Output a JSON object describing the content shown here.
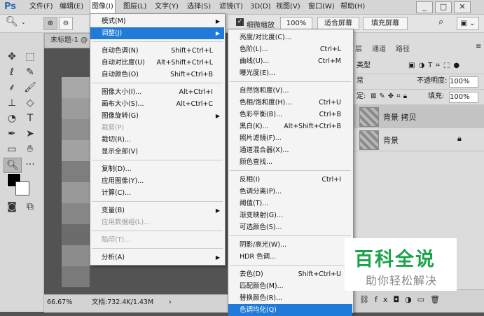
{
  "menubar": {
    "logo": "Ps",
    "items": [
      "文件(F)",
      "编辑(E)",
      "图像(I)",
      "图层(L)",
      "文字(Y)",
      "选择(S)",
      "滤镜(T)",
      "3D(D)",
      "视图(V)",
      "窗口(W)",
      "帮助(H)"
    ],
    "active_index": 2
  },
  "options_bar": {
    "scrubby_zoom_label": "细微缩放",
    "zoom_100": "100%",
    "fit_screen": "适合屏幕",
    "fill_screen": "填充屏幕"
  },
  "document": {
    "tab_title": "未标题-1 @",
    "zoom": "66.67%",
    "doc_size": "文档:732.4K/1.43M"
  },
  "image_menu": {
    "items": [
      {
        "label": "模式(M)",
        "shortcut": "",
        "arrow": true
      },
      {
        "label": "调整(J)",
        "shortcut": "",
        "arrow": true,
        "highlight": true
      },
      {
        "label": "自动色调(N)",
        "shortcut": "Shift+Ctrl+L"
      },
      {
        "label": "自动对比度(U)",
        "shortcut": "Alt+Shift+Ctrl+L"
      },
      {
        "label": "自动颜色(O)",
        "shortcut": "Shift+Ctrl+B"
      },
      {
        "label": "图像大小(I)...",
        "shortcut": "Alt+Ctrl+I"
      },
      {
        "label": "画布大小(S)...",
        "shortcut": "Alt+Ctrl+C"
      },
      {
        "label": "图像旋转(G)",
        "shortcut": "",
        "arrow": true
      },
      {
        "label": "裁剪(P)",
        "shortcut": "",
        "disabled": true
      },
      {
        "label": "裁切(R)...",
        "shortcut": ""
      },
      {
        "label": "显示全部(V)",
        "shortcut": ""
      },
      {
        "label": "复制(D)...",
        "shortcut": ""
      },
      {
        "label": "应用图像(Y)...",
        "shortcut": ""
      },
      {
        "label": "计算(C)...",
        "shortcut": ""
      },
      {
        "label": "变量(B)",
        "shortcut": "",
        "arrow": true
      },
      {
        "label": "应用数据组(L)...",
        "shortcut": "",
        "disabled": true
      },
      {
        "label": "陷印(T)...",
        "shortcut": "",
        "disabled": true
      },
      {
        "label": "分析(A)",
        "shortcut": "",
        "arrow": true
      }
    ]
  },
  "adjust_menu": {
    "items": [
      {
        "label": "亮度/对比度(C)...",
        "shortcut": ""
      },
      {
        "label": "色阶(L)...",
        "shortcut": "Ctrl+L"
      },
      {
        "label": "曲线(U)...",
        "shortcut": "Ctrl+M"
      },
      {
        "label": "曝光度(E)...",
        "shortcut": ""
      },
      {
        "label": "自然饱和度(V)...",
        "shortcut": ""
      },
      {
        "label": "色相/饱和度(H)...",
        "shortcut": "Ctrl+U"
      },
      {
        "label": "色彩平衡(B)...",
        "shortcut": "Ctrl+B"
      },
      {
        "label": "黑白(K)...",
        "shortcut": "Alt+Shift+Ctrl+B"
      },
      {
        "label": "照片滤镜(F)...",
        "shortcut": ""
      },
      {
        "label": "通道混合器(X)...",
        "shortcut": ""
      },
      {
        "label": "颜色查找...",
        "shortcut": ""
      },
      {
        "label": "反相(I)",
        "shortcut": "Ctrl+I"
      },
      {
        "label": "色调分离(P)...",
        "shortcut": ""
      },
      {
        "label": "阈值(T)...",
        "shortcut": ""
      },
      {
        "label": "渐变映射(G)...",
        "shortcut": ""
      },
      {
        "label": "可选颜色(S)...",
        "shortcut": ""
      },
      {
        "label": "阴影/高光(W)...",
        "shortcut": ""
      },
      {
        "label": "HDR 色调...",
        "shortcut": ""
      },
      {
        "label": "去色(D)",
        "shortcut": "Shift+Ctrl+U"
      },
      {
        "label": "匹配颜色(M)...",
        "shortcut": ""
      },
      {
        "label": "替换颜色(R)...",
        "shortcut": ""
      },
      {
        "label": "色调均化(Q)",
        "shortcut": "",
        "highlight": true
      }
    ]
  },
  "layers_panel": {
    "tabs": [
      "层",
      "通道",
      "路径"
    ],
    "kind_label": "类型",
    "blend_mode": "常",
    "opacity_label": "不透明度:",
    "opacity_value": "100%",
    "lock_label": "定:",
    "fill_label": "填充:",
    "fill_value": "100%",
    "layers": [
      "背景 拷贝",
      "背景"
    ]
  },
  "watermark": {
    "title": "百科全说",
    "subtitle": "助你轻松解决",
    "color": "#1aa34a"
  },
  "colors": {
    "highlight": "#1f7ad9",
    "app_bg": "#535353"
  }
}
